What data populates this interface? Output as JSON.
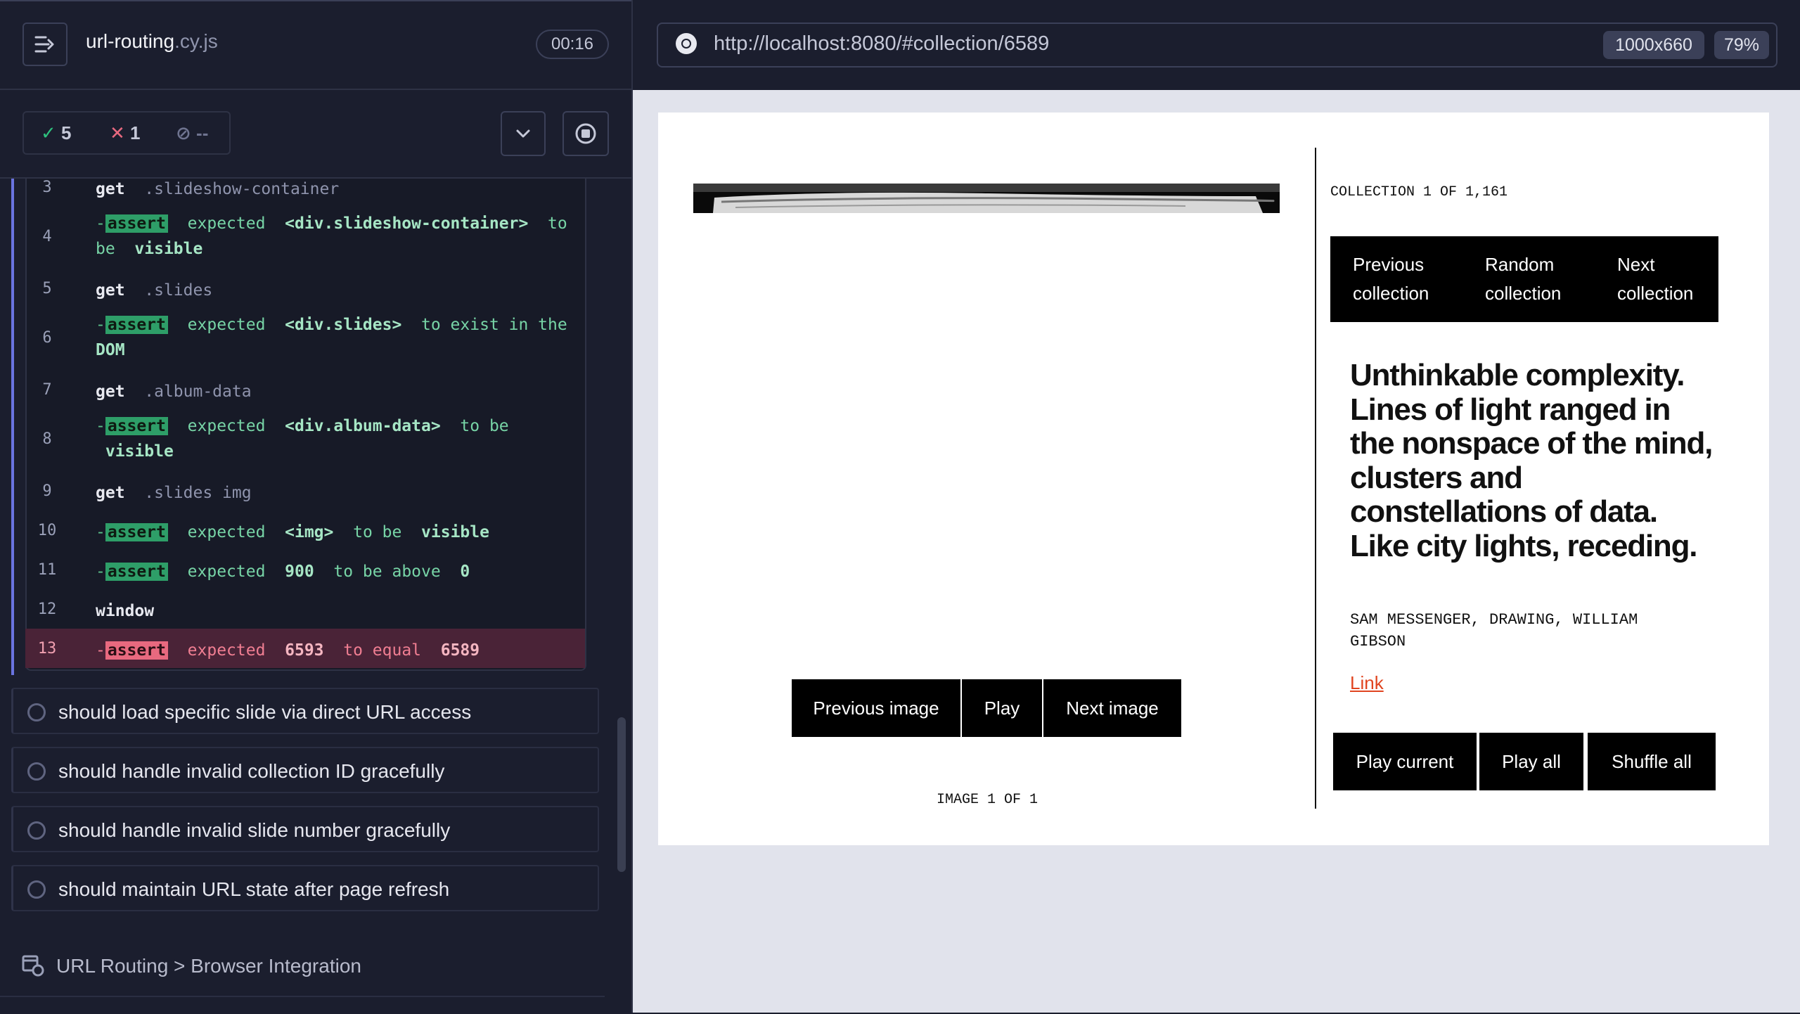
{
  "runner": {
    "spec_name": "url-routing",
    "spec_ext": ".cy.js",
    "timer": "00:16",
    "passed": "5",
    "failed": "1",
    "pending": "--"
  },
  "commands": [
    {
      "n": "3",
      "kind": "get",
      "text": ".slideshow-container"
    },
    {
      "n": "4",
      "kind": "assert",
      "parts": [
        "expected",
        "<div.slideshow-container>",
        "to",
        "be",
        "visible"
      ]
    },
    {
      "n": "5",
      "kind": "get",
      "text": ".slides"
    },
    {
      "n": "6",
      "kind": "assert",
      "parts": [
        "expected",
        "<div.slides>",
        "to exist in the",
        "DOM"
      ]
    },
    {
      "n": "7",
      "kind": "get",
      "text": ".album-data"
    },
    {
      "n": "8",
      "kind": "assert",
      "parts": [
        "expected",
        "<div.album-data>",
        "to be",
        "visible"
      ]
    },
    {
      "n": "9",
      "kind": "get",
      "text": ".slides img"
    },
    {
      "n": "10",
      "kind": "assert",
      "parts": [
        "expected",
        "<img>",
        "to be",
        "visible"
      ]
    },
    {
      "n": "11",
      "kind": "assert",
      "parts": [
        "expected",
        "900",
        "to be above",
        "0"
      ]
    },
    {
      "n": "12",
      "kind": "window",
      "text": "window"
    },
    {
      "n": "13",
      "kind": "assert-fail",
      "parts": [
        "expected",
        "6593",
        "to equal",
        "6589"
      ]
    }
  ],
  "labels": {
    "get": "get",
    "assert": "assert",
    "dash": "-"
  },
  "tests": [
    "should load specific slide via direct URL access",
    "should handle invalid collection ID gracefully",
    "should handle invalid slide number gracefully",
    "should maintain URL state after page refresh"
  ],
  "suite_title": "URL Routing > Browser Integration",
  "browser": {
    "url": "http://localhost:8080/#collection/6589",
    "viewport": "1000x660",
    "zoom": "79%"
  },
  "app": {
    "image_buttons": [
      "Previous image",
      "Play",
      "Next image"
    ],
    "image_count": "IMAGE 1 OF 1",
    "collection_count": "COLLECTION 1 OF 1,161",
    "collection_nav": [
      [
        "Previous",
        "collection"
      ],
      [
        "Random",
        "collection"
      ],
      [
        "Next",
        "collection"
      ]
    ],
    "quote": "Unthinkable complexity. Lines of light ranged in the nonspace of the mind, clusters and constellations of data. Like city lights, receding.",
    "credit": "SAM MESSENGER, DRAWING, WILLIAM GIBSON",
    "link_label": "Link",
    "play_buttons": [
      "Play current",
      "Play all",
      "Shuffle all"
    ]
  },
  "colors": {
    "pass": "#2e9e68",
    "fail": "#e8697f",
    "accent": "#6a74e0",
    "link": "#e0441f"
  }
}
